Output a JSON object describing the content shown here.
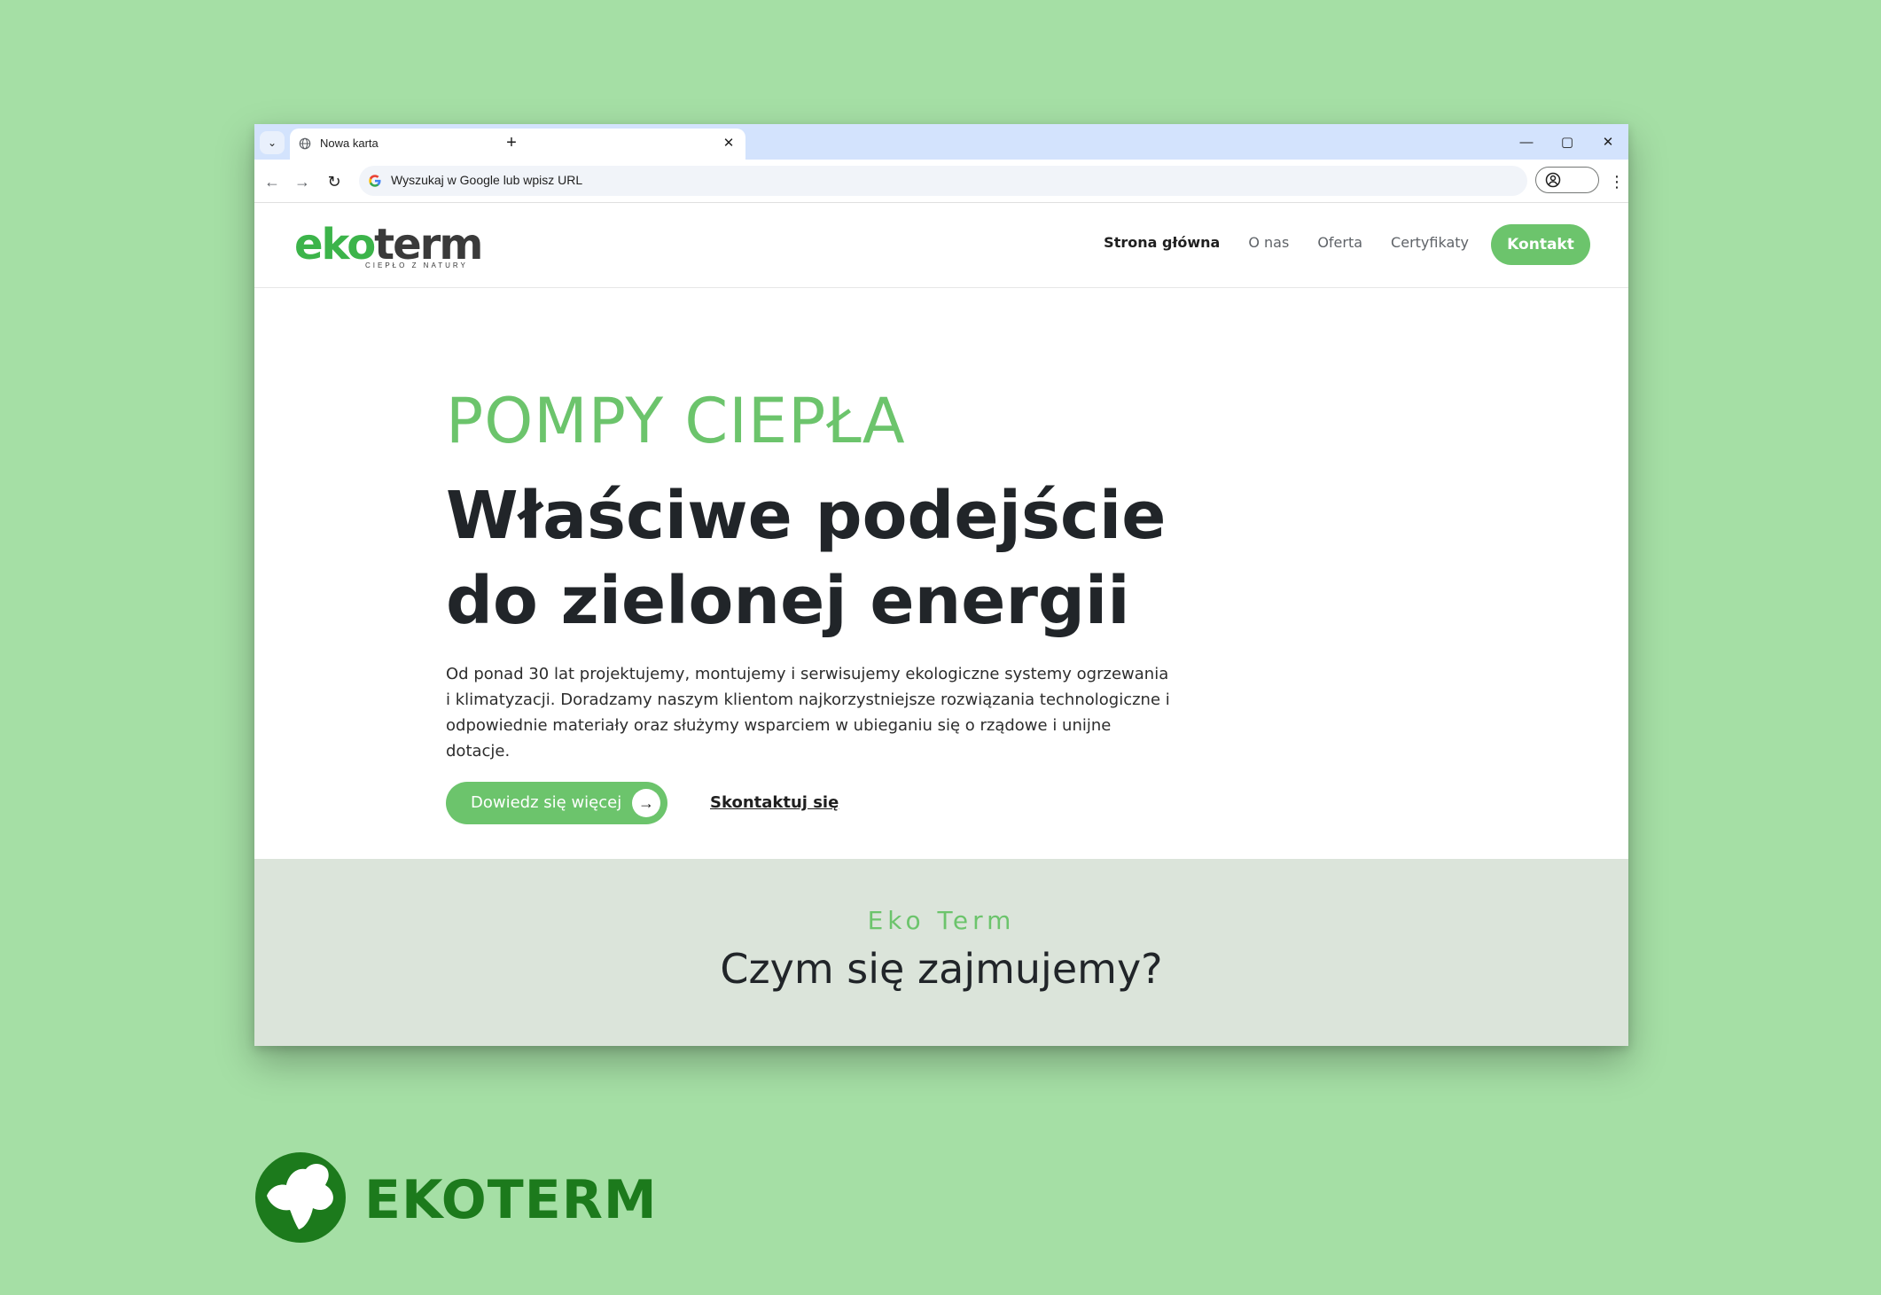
{
  "browser": {
    "tab_title": "Nowa karta",
    "omnibox_placeholder": "Wyszukaj w Google lub wpisz URL",
    "new_tab_symbol": "+",
    "close_symbol": "✕",
    "minimize_symbol": "—",
    "maximize_symbol": "▢",
    "back_symbol": "←",
    "forward_symbol": "→",
    "reload_symbol": "↻",
    "menu_symbol": "⋮",
    "tab_search_symbol": "⌄"
  },
  "site": {
    "logo_prefix": "eko",
    "logo_suffix": "term",
    "logo_tagline": "CIEPŁO Z NATURY",
    "nav": [
      {
        "label": "Strona główna",
        "active": true
      },
      {
        "label": "O nas",
        "active": false
      },
      {
        "label": "Oferta",
        "active": false
      },
      {
        "label": "Certyfikaty",
        "active": false
      }
    ],
    "cta_label": "Kontakt",
    "hero": {
      "kicker": "POMPY CIEPŁA",
      "title": "Właściwe podejście do zielonej energii",
      "description": "Od ponad 30 lat projektujemy, montujemy i serwisujemy ekologiczne systemy ogrzewania i klimatyzacji. Doradzamy naszym klientom najkorzystniejsze rozwiązania technologiczne i odpowiednie materiały oraz służymy wsparciem w ubieganiu się o rządowe i unijne dotacje.",
      "primary_button": "Dowiedz się więcej",
      "arrow_symbol": "→",
      "secondary_link": "Skontaktuj się"
    },
    "section": {
      "kicker": "Eko Term",
      "title": "Czym się zajmujemy?"
    }
  },
  "brand": {
    "name": "EKOTERM"
  },
  "colors": {
    "background": "#a5dfa5",
    "accent": "#6cc46c",
    "logo_green": "#3cb44a",
    "brand_dark_green": "#1c7a1c",
    "section_bg": "#dbe4da"
  }
}
